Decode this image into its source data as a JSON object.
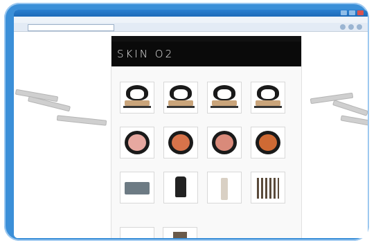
{
  "browser": {
    "title": "",
    "menu": "",
    "address": ""
  },
  "site": {
    "logo": "SKIN O2",
    "nav": [
      "",
      "",
      "",
      "",
      ""
    ],
    "section_title": "",
    "subsection_title": ""
  },
  "products": [
    {
      "name": "",
      "art": "kit"
    },
    {
      "name": "",
      "art": "kit"
    },
    {
      "name": "",
      "art": "kit"
    },
    {
      "name": "",
      "art": "kit"
    },
    {
      "name": "",
      "art": "pan",
      "color": "#e7a8a0"
    },
    {
      "name": "",
      "art": "pan",
      "color": "#d8734a"
    },
    {
      "name": "",
      "art": "pan",
      "color": "#d98a7a"
    },
    {
      "name": "",
      "art": "pan",
      "color": "#cf6a34"
    },
    {
      "name": "",
      "art": "acc-a"
    },
    {
      "name": "",
      "art": "acc-b"
    },
    {
      "name": "",
      "art": "acc-c"
    },
    {
      "name": "",
      "art": "acc-d"
    }
  ],
  "colors": {
    "frame": "#3b8fd8",
    "header": "#0a0a0a",
    "link": "#3a6ea5"
  }
}
